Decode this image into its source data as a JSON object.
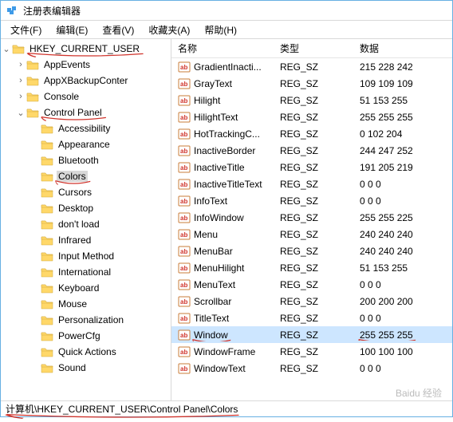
{
  "window": {
    "title": "注册表编辑器"
  },
  "menubar": [
    {
      "label": "文件(F)"
    },
    {
      "label": "编辑(E)"
    },
    {
      "label": "查看(V)"
    },
    {
      "label": "收藏夹(A)"
    },
    {
      "label": "帮助(H)"
    }
  ],
  "tree": {
    "root": {
      "label": "HKEY_CURRENT_USER",
      "expanded": true,
      "marked": true,
      "children": [
        {
          "label": "AppEvents",
          "hasChildren": true
        },
        {
          "label": "AppXBackupConter",
          "hasChildren": true
        },
        {
          "label": "Console",
          "hasChildren": true
        },
        {
          "label": "Control Panel",
          "hasChildren": true,
          "expanded": true,
          "marked": true,
          "children": [
            {
              "label": "Accessibility"
            },
            {
              "label": "Appearance"
            },
            {
              "label": "Bluetooth"
            },
            {
              "label": "Colors",
              "selected": true,
              "marked": true
            },
            {
              "label": "Cursors"
            },
            {
              "label": "Desktop"
            },
            {
              "label": "don't load"
            },
            {
              "label": "Infrared"
            },
            {
              "label": "Input Method"
            },
            {
              "label": "International"
            },
            {
              "label": "Keyboard"
            },
            {
              "label": "Mouse"
            },
            {
              "label": "Personalization"
            },
            {
              "label": "PowerCfg"
            },
            {
              "label": "Quick Actions"
            },
            {
              "label": "Sound"
            }
          ]
        }
      ]
    }
  },
  "list": {
    "columns": {
      "name": "名称",
      "type": "类型",
      "data": "数据"
    },
    "rows": [
      {
        "name": "GradientInacti...",
        "type": "REG_SZ",
        "data": "215 228 242"
      },
      {
        "name": "GrayText",
        "type": "REG_SZ",
        "data": "109 109 109"
      },
      {
        "name": "Hilight",
        "type": "REG_SZ",
        "data": "51 153 255"
      },
      {
        "name": "HilightText",
        "type": "REG_SZ",
        "data": "255 255 255"
      },
      {
        "name": "HotTrackingC...",
        "type": "REG_SZ",
        "data": "0 102 204"
      },
      {
        "name": "InactiveBorder",
        "type": "REG_SZ",
        "data": "244 247 252"
      },
      {
        "name": "InactiveTitle",
        "type": "REG_SZ",
        "data": "191 205 219"
      },
      {
        "name": "InactiveTitleText",
        "type": "REG_SZ",
        "data": "0 0 0"
      },
      {
        "name": "InfoText",
        "type": "REG_SZ",
        "data": "0 0 0"
      },
      {
        "name": "InfoWindow",
        "type": "REG_SZ",
        "data": "255 255 225"
      },
      {
        "name": "Menu",
        "type": "REG_SZ",
        "data": "240 240 240"
      },
      {
        "name": "MenuBar",
        "type": "REG_SZ",
        "data": "240 240 240"
      },
      {
        "name": "MenuHilight",
        "type": "REG_SZ",
        "data": "51 153 255"
      },
      {
        "name": "MenuText",
        "type": "REG_SZ",
        "data": "0 0 0"
      },
      {
        "name": "Scrollbar",
        "type": "REG_SZ",
        "data": "200 200 200"
      },
      {
        "name": "TitleText",
        "type": "REG_SZ",
        "data": "0 0 0"
      },
      {
        "name": "Window",
        "type": "REG_SZ",
        "data": "255 255 255",
        "selected": true,
        "nameMarked": true,
        "dataMarked": true
      },
      {
        "name": "WindowFrame",
        "type": "REG_SZ",
        "data": "100 100 100"
      },
      {
        "name": "WindowText",
        "type": "REG_SZ",
        "data": "0 0 0"
      }
    ]
  },
  "statusbar": {
    "path": "计算机\\HKEY_CURRENT_USER\\Control Panel\\Colors",
    "marked": true
  },
  "watermark": "Baidu 经验"
}
